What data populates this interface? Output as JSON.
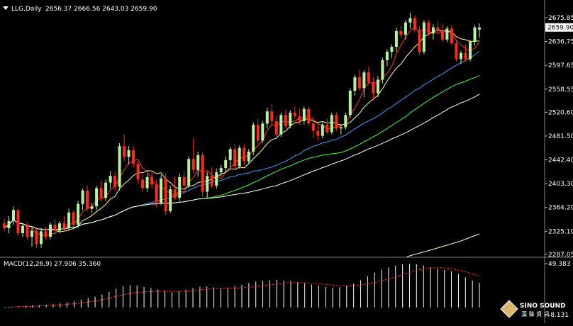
{
  "header": {
    "symbol": "LLG,Daily",
    "ohlc": "2656.37 2666.56 2643.03 2659.90"
  },
  "macd_header": "MACD(12,26,9) 27.906 35.360",
  "watermark": {
    "brand": "SINO SOUND",
    "sub": "漢 聲 資 訊"
  },
  "colors": {
    "background": "#000000",
    "bull": "#b8f0a0",
    "bear": "#ff2a1a",
    "ma_red": "#ff3030",
    "ma_yellow": "#ffff88",
    "ma_blue": "#3aa0ff",
    "ma_green": "#3cff3c",
    "ma_white": "#ffffff",
    "ma_olive": "#ffffb0",
    "macd_hist": "#ffffff",
    "macd_signal": "#ff2a1a",
    "axis": "#c0c0c0"
  },
  "chart_data": [
    {
      "type": "candlestick",
      "title": "LLG,Daily",
      "current_price_label": "2659.90",
      "y_ticks": [
        "2675.85",
        "2636.75",
        "2597.65",
        "2558.55",
        "2520.60",
        "2481.50",
        "2442.40",
        "2403.30",
        "2364.20",
        "2325.10",
        "2287.05"
      ],
      "ylim": [
        2287.05,
        2675.85
      ],
      "candles": [
        [
          2338,
          2346,
          2325,
          2330
        ],
        [
          2330,
          2350,
          2322,
          2342
        ],
        [
          2342,
          2366,
          2336,
          2360
        ],
        [
          2360,
          2362,
          2318,
          2322
        ],
        [
          2322,
          2338,
          2316,
          2334
        ],
        [
          2334,
          2340,
          2312,
          2316
        ],
        [
          2316,
          2330,
          2300,
          2326
        ],
        [
          2326,
          2332,
          2298,
          2304
        ],
        [
          2304,
          2330,
          2298,
          2325
        ],
        [
          2325,
          2332,
          2312,
          2316
        ],
        [
          2316,
          2340,
          2312,
          2336
        ],
        [
          2336,
          2345,
          2320,
          2326
        ],
        [
          2326,
          2342,
          2322,
          2338
        ],
        [
          2338,
          2350,
          2325,
          2330
        ],
        [
          2330,
          2362,
          2326,
          2356
        ],
        [
          2356,
          2360,
          2332,
          2336
        ],
        [
          2336,
          2375,
          2330,
          2370
        ],
        [
          2370,
          2395,
          2360,
          2392
        ],
        [
          2392,
          2400,
          2358,
          2362
        ],
        [
          2362,
          2372,
          2355,
          2366
        ],
        [
          2366,
          2400,
          2360,
          2396
        ],
        [
          2396,
          2408,
          2374,
          2380
        ],
        [
          2380,
          2410,
          2375,
          2405
        ],
        [
          2405,
          2424,
          2395,
          2416
        ],
        [
          2416,
          2422,
          2392,
          2398
        ],
        [
          2398,
          2470,
          2392,
          2465
        ],
        [
          2465,
          2484,
          2440,
          2447
        ],
        [
          2447,
          2465,
          2435,
          2458
        ],
        [
          2458,
          2465,
          2430,
          2436
        ],
        [
          2436,
          2440,
          2403,
          2410
        ],
        [
          2410,
          2420,
          2390,
          2396
        ],
        [
          2396,
          2420,
          2390,
          2414
        ],
        [
          2414,
          2422,
          2395,
          2402
        ],
        [
          2402,
          2410,
          2365,
          2372
        ],
        [
          2372,
          2418,
          2368,
          2412
        ],
        [
          2412,
          2420,
          2352,
          2358
        ],
        [
          2358,
          2400,
          2355,
          2394
        ],
        [
          2394,
          2415,
          2376,
          2380
        ],
        [
          2380,
          2420,
          2375,
          2414
        ],
        [
          2414,
          2424,
          2394,
          2400
        ],
        [
          2400,
          2448,
          2396,
          2444
        ],
        [
          2444,
          2478,
          2420,
          2426
        ],
        [
          2426,
          2456,
          2415,
          2450
        ],
        [
          2450,
          2455,
          2382,
          2390
        ],
        [
          2390,
          2422,
          2380,
          2416
        ],
        [
          2416,
          2430,
          2395,
          2400
        ],
        [
          2400,
          2428,
          2395,
          2422
        ],
        [
          2422,
          2434,
          2415,
          2429
        ],
        [
          2429,
          2448,
          2422,
          2442
        ],
        [
          2442,
          2464,
          2430,
          2460
        ],
        [
          2460,
          2468,
          2428,
          2432
        ],
        [
          2432,
          2466,
          2428,
          2462
        ],
        [
          2462,
          2468,
          2434,
          2440
        ],
        [
          2440,
          2460,
          2436,
          2456
        ],
        [
          2456,
          2504,
          2450,
          2500
        ],
        [
          2500,
          2510,
          2468,
          2474
        ],
        [
          2474,
          2506,
          2470,
          2502
        ],
        [
          2502,
          2528,
          2494,
          2522
        ],
        [
          2522,
          2534,
          2500,
          2506
        ],
        [
          2506,
          2515,
          2478,
          2484
        ],
        [
          2484,
          2520,
          2480,
          2516
        ],
        [
          2516,
          2524,
          2494,
          2498
        ],
        [
          2498,
          2524,
          2494,
          2520
        ],
        [
          2520,
          2530,
          2510,
          2514
        ],
        [
          2514,
          2526,
          2500,
          2506
        ],
        [
          2506,
          2530,
          2500,
          2526
        ],
        [
          2526,
          2530,
          2498,
          2502
        ],
        [
          2502,
          2514,
          2478,
          2490
        ],
        [
          2490,
          2500,
          2474,
          2482
        ],
        [
          2482,
          2504,
          2478,
          2500
        ],
        [
          2500,
          2510,
          2485,
          2488
        ],
        [
          2488,
          2520,
          2484,
          2516
        ],
        [
          2516,
          2520,
          2490,
          2494
        ],
        [
          2494,
          2500,
          2484,
          2496
        ],
        [
          2496,
          2520,
          2492,
          2516
        ],
        [
          2516,
          2560,
          2512,
          2556
        ],
        [
          2556,
          2582,
          2548,
          2578
        ],
        [
          2578,
          2590,
          2556,
          2560
        ],
        [
          2560,
          2590,
          2545,
          2586
        ],
        [
          2586,
          2596,
          2566,
          2570
        ],
        [
          2570,
          2578,
          2540,
          2552
        ],
        [
          2552,
          2580,
          2545,
          2574
        ],
        [
          2574,
          2610,
          2568,
          2606
        ],
        [
          2606,
          2624,
          2596,
          2620
        ],
        [
          2620,
          2632,
          2610,
          2628
        ],
        [
          2628,
          2660,
          2620,
          2654
        ],
        [
          2654,
          2662,
          2642,
          2648
        ],
        [
          2648,
          2672,
          2640,
          2668
        ],
        [
          2668,
          2684,
          2658,
          2675
        ],
        [
          2675,
          2680,
          2652,
          2656
        ],
        [
          2656,
          2662,
          2615,
          2620
        ],
        [
          2620,
          2672,
          2616,
          2668
        ],
        [
          2668,
          2672,
          2646,
          2650
        ],
        [
          2650,
          2665,
          2640,
          2660
        ],
        [
          2660,
          2670,
          2650,
          2654
        ],
        [
          2654,
          2666,
          2636,
          2640
        ],
        [
          2640,
          2662,
          2636,
          2658
        ],
        [
          2658,
          2664,
          2630,
          2634
        ],
        [
          2634,
          2640,
          2604,
          2608
        ],
        [
          2608,
          2622,
          2600,
          2618
        ],
        [
          2618,
          2632,
          2604,
          2608
        ],
        [
          2608,
          2640,
          2604,
          2636
        ],
        [
          2636,
          2664,
          2630,
          2660
        ],
        [
          2656.37,
          2666.56,
          2643.03,
          2659.9
        ]
      ]
    },
    {
      "type": "bar",
      "title": "MACD(12,26,9)",
      "y_ticks": [
        "49.383",
        "-8.131"
      ],
      "ylim": [
        -8.131,
        49.383
      ],
      "series": [
        {
          "name": "MACD",
          "values": [
            0.5,
            0.8,
            1.4,
            1.8,
            2.2,
            2.6,
            3.0,
            3.6,
            4.5,
            5.8,
            7.2,
            8.8,
            10.4,
            12.2,
            14.6,
            17.8,
            21.2,
            23.8,
            25.2,
            24.6,
            23.0,
            21.8,
            20.2,
            18.6,
            17.0,
            18.2,
            20.0,
            21.8,
            23.2,
            23.6,
            22.6,
            21.8,
            22.4,
            23.8,
            25.6,
            27.4,
            29.0,
            30.0,
            30.6,
            31.0,
            30.4,
            29.6,
            28.6,
            27.2,
            25.8,
            24.6,
            23.4,
            22.4,
            22.8,
            24.6,
            27.0,
            30.6,
            35.0,
            39.2,
            42.6,
            45.2,
            47.2,
            48.6,
            49.2,
            48.8,
            47.4,
            45.6,
            43.8,
            42.2,
            40.6,
            37.8,
            34.0,
            30.4,
            27.906
          ]
        },
        {
          "name": "Signal",
          "values": [
            0.2,
            0.4,
            0.7,
            1.0,
            1.3,
            1.6,
            2.0,
            2.4,
            2.9,
            3.5,
            4.2,
            5.1,
            6.1,
            7.3,
            8.8,
            10.6,
            12.5,
            14.2,
            15.8,
            17.0,
            17.6,
            18.0,
            18.3,
            18.4,
            18.2,
            18.0,
            18.4,
            19.0,
            19.8,
            20.6,
            21.2,
            21.4,
            21.6,
            21.8,
            22.2,
            22.8,
            23.6,
            24.4,
            25.4,
            26.6,
            27.4,
            27.8,
            28.0,
            27.8,
            27.4,
            26.8,
            26.0,
            25.2,
            24.6,
            24.4,
            24.6,
            25.4,
            26.6,
            28.2,
            30.0,
            32.2,
            34.6,
            37.0,
            39.6,
            41.8,
            43.4,
            44.4,
            44.8,
            44.6,
            43.8,
            42.2,
            40.2,
            37.8,
            35.36
          ]
        }
      ]
    }
  ]
}
